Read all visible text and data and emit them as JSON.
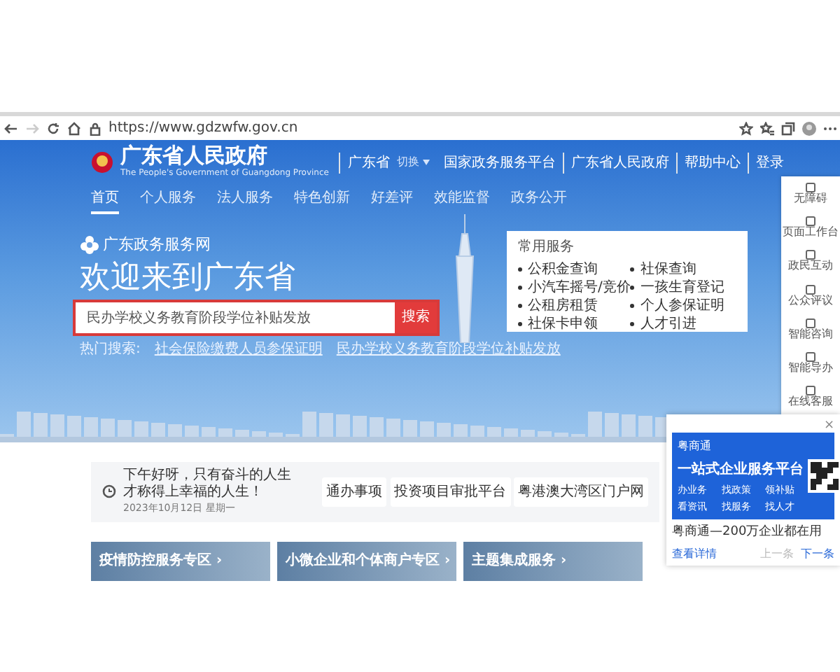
{
  "browser": {
    "url": "https://www.gdzwfw.gov.cn"
  },
  "header": {
    "title": "广东省人民政府",
    "subtitle": "The People's Government of Guangdong Province",
    "region": "广东省",
    "switch": "切换",
    "switch_expanded": false,
    "links": [
      "国家政务服务平台",
      "广东省人民政府",
      "帮助中心",
      "登录"
    ]
  },
  "nav": [
    {
      "label": "首页",
      "selected": true
    },
    {
      "label": "个人服务",
      "selected": false
    },
    {
      "label": "法人服务",
      "selected": false
    },
    {
      "label": "特色创新",
      "selected": false
    },
    {
      "label": "好差评",
      "selected": false
    },
    {
      "label": "效能监督",
      "selected": false
    },
    {
      "label": "政务公开",
      "selected": false
    }
  ],
  "hero": {
    "brand": "广东政务服务网",
    "heading": "欢迎来到广东省",
    "search": {
      "value": "民办学校义务教育阶段学位补贴发放",
      "button": "搜索"
    },
    "hot_label": "热门搜索:",
    "hot_links": [
      "社会保险缴费人员参保证明",
      "民办学校义务教育阶段学位补贴发放"
    ]
  },
  "services": {
    "title": "常用服务",
    "items": [
      "公积金查询",
      "社保查询",
      "小汽车摇号/竞价",
      "一孩生育登记",
      "公租房租赁",
      "个人参保证明",
      "社保卡申领",
      "人才引进"
    ]
  },
  "sidebar": [
    "无障碍",
    "页面工作台",
    "政民互动",
    "公众评议",
    "智能咨询",
    "智能导办",
    "在线客服"
  ],
  "notice": {
    "text": "下午好呀，只有奋斗的人生才称得上幸福的人生！",
    "date": "2023年10月12日 星期一",
    "buttons": [
      "通办事项",
      "投资项目审批平台",
      "粤港澳大湾区门户网"
    ]
  },
  "cards": [
    "疫情防控服务专区 ›",
    "小微企业和个体商户专区 ›",
    "主题集成服务 ›"
  ],
  "popup": {
    "close": "×",
    "brand": "粤商通",
    "title": "一站式企业服务平台",
    "features": [
      "办业务",
      "找政策",
      "领补贴",
      "看资讯",
      "找服务",
      "找人才"
    ],
    "caption": "粤商通—200万企业都在用",
    "details": "查看详情",
    "prev": "上一条",
    "next": "下一条"
  }
}
